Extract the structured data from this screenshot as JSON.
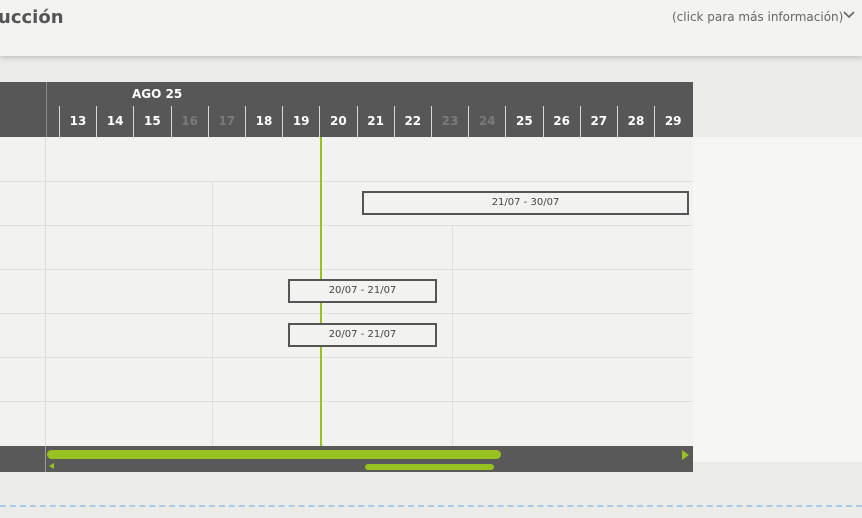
{
  "header": {
    "title": "ucción",
    "info_link": "(click para más información)"
  },
  "timeline": {
    "month": "AGO 25",
    "days": [
      {
        "label": "13",
        "weekend": false
      },
      {
        "label": "14",
        "weekend": false
      },
      {
        "label": "15",
        "weekend": false
      },
      {
        "label": "16",
        "weekend": true
      },
      {
        "label": "17",
        "weekend": true
      },
      {
        "label": "18",
        "weekend": false
      },
      {
        "label": "19",
        "weekend": false
      },
      {
        "label": "20",
        "weekend": false
      },
      {
        "label": "21",
        "weekend": false
      },
      {
        "label": "22",
        "weekend": false
      },
      {
        "label": "23",
        "weekend": true
      },
      {
        "label": "24",
        "weekend": true
      },
      {
        "label": "25",
        "weekend": false
      },
      {
        "label": "26",
        "weekend": false
      },
      {
        "label": "27",
        "weekend": false
      },
      {
        "label": "28",
        "weekend": false
      },
      {
        "label": "29",
        "weekend": false
      }
    ]
  },
  "tasks": [
    {
      "label": "21/07 - 30/07"
    },
    {
      "label": "20/07 - 21/07"
    },
    {
      "label": "20/07 - 21/07"
    }
  ],
  "colors": {
    "accent": "#96c11f",
    "header_bg": "#575757",
    "grid_bg": "#f2f2f0"
  },
  "icons": {
    "expand": "chevron-down-icon"
  }
}
